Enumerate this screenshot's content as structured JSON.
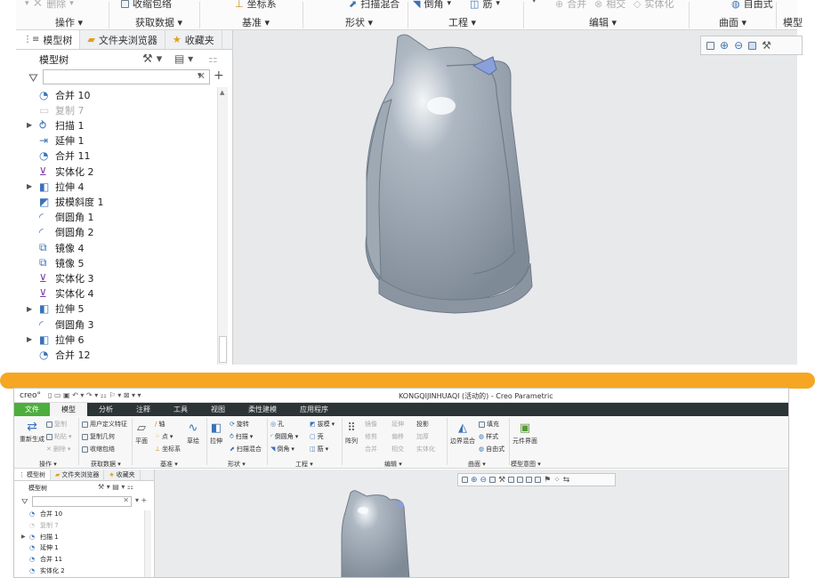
{
  "top": {
    "ribbon_items": [
      {
        "label": "删除",
        "disabled": true
      },
      {
        "label": "收缩包络",
        "disabled": false
      },
      {
        "label": "坐标系",
        "disabled": false
      },
      {
        "label": "扫描混合",
        "disabled": false
      },
      {
        "label": "倒角",
        "disabled": false
      },
      {
        "label": "筋",
        "disabled": false
      },
      {
        "label": "合并",
        "disabled": true
      },
      {
        "label": "相交",
        "disabled": true
      },
      {
        "label": "实体化",
        "disabled": true
      },
      {
        "label": "自由式",
        "disabled": false
      }
    ],
    "group_labels": [
      "操作",
      "获取数据",
      "基准",
      "形状",
      "工程",
      "编辑",
      "曲面",
      "模型"
    ],
    "tabs": [
      "模型树",
      "文件夹浏览器",
      "收藏夹"
    ],
    "model_tree_header": "模型树",
    "filter_value": "",
    "tree_rows": [
      {
        "label": "合并 10",
        "expandable": false,
        "dim": false,
        "icon": "merge-icon"
      },
      {
        "label": "复制 7",
        "expandable": false,
        "dim": true,
        "icon": "copy-icon"
      },
      {
        "label": "扫描 1",
        "expandable": true,
        "dim": false,
        "icon": "sweep-icon"
      },
      {
        "label": "延伸 1",
        "expandable": false,
        "dim": false,
        "icon": "extend-icon"
      },
      {
        "label": "合并 11",
        "expandable": false,
        "dim": false,
        "icon": "merge-icon"
      },
      {
        "label": "实体化 2",
        "expandable": false,
        "dim": false,
        "icon": "solidify-icon"
      },
      {
        "label": "拉伸 4",
        "expandable": true,
        "dim": false,
        "icon": "extrude-icon"
      },
      {
        "label": "拔模斜度 1",
        "expandable": false,
        "dim": false,
        "icon": "draft-icon"
      },
      {
        "label": "倒圆角 1",
        "expandable": false,
        "dim": false,
        "icon": "round-icon"
      },
      {
        "label": "倒圆角 2",
        "expandable": false,
        "dim": false,
        "icon": "round-icon"
      },
      {
        "label": "镜像 4",
        "expandable": false,
        "dim": false,
        "icon": "mirror-icon"
      },
      {
        "label": "镜像 5",
        "expandable": false,
        "dim": false,
        "icon": "mirror-icon"
      },
      {
        "label": "实体化 3",
        "expandable": false,
        "dim": false,
        "icon": "solidify-icon"
      },
      {
        "label": "实体化 4",
        "expandable": false,
        "dim": false,
        "icon": "solidify-icon"
      },
      {
        "label": "拉伸 5",
        "expandable": true,
        "dim": false,
        "icon": "extrude-icon"
      },
      {
        "label": "倒圆角 3",
        "expandable": false,
        "dim": false,
        "icon": "round-icon"
      },
      {
        "label": "拉伸 6",
        "expandable": true,
        "dim": false,
        "icon": "extrude-icon"
      },
      {
        "label": "合并 12",
        "expandable": false,
        "dim": false,
        "icon": "merge-icon"
      }
    ]
  },
  "bottom": {
    "logo": "creo°",
    "window_title": "KONGQIJINHUAQI (活动的) - Creo Parametric",
    "menus": [
      "文件",
      "模型",
      "分析",
      "注释",
      "工具",
      "视图",
      "柔性建模",
      "应用程序"
    ],
    "active_menu": "模型",
    "ribbon": {
      "ops": {
        "regen": "重新生成",
        "copy": "复制",
        "paste": "粘贴",
        "delete": "删除"
      },
      "get_data": {
        "udf": "用户定义特征",
        "copy_geom": "复制几何",
        "shrinkwrap": "收缩包络"
      },
      "datum": {
        "plane": "平面",
        "axis": "轴",
        "point": "点",
        "csys": "坐标系",
        "sketch": "草绘"
      },
      "shape": {
        "extrude": "拉伸",
        "revolve": "旋转",
        "sweep": "扫描",
        "swept_blend": "扫描混合"
      },
      "engineering": {
        "hole": "孔",
        "round": "倒圆角",
        "chamfer": "倒角",
        "draft": "拔模",
        "shell": "壳",
        "rib": "筋"
      },
      "edit": {
        "pattern": "阵列",
        "mirror": "镜像",
        "trim": "修剪",
        "merge": "合并",
        "extend": "延伸",
        "offset": "偏移",
        "intersect": "相交",
        "project": "投影",
        "thicken": "加厚",
        "solidify": "实体化"
      },
      "surfaces": {
        "boundary_blend": "边界混合",
        "fill": "填充",
        "style": "样式",
        "freestyle": "自由式"
      },
      "model_intent": {
        "component_interface": "元件界面"
      }
    },
    "group_labels": [
      "操作",
      "获取数据",
      "基准",
      "形状",
      "工程",
      "编辑",
      "曲面",
      "模型意图"
    ],
    "tabs": [
      "模型树",
      "文件夹浏览器",
      "收藏夹"
    ],
    "model_tree_header": "模型树",
    "tree_rows": [
      {
        "label": "合并 10",
        "expandable": false,
        "dim": false
      },
      {
        "label": "复制 7",
        "expandable": false,
        "dim": true
      },
      {
        "label": "扫描 1",
        "expandable": true,
        "dim": false
      },
      {
        "label": "延伸 1",
        "expandable": false,
        "dim": false
      },
      {
        "label": "合并 11",
        "expandable": false,
        "dim": false
      },
      {
        "label": "实体化 2",
        "expandable": false,
        "dim": false
      }
    ]
  },
  "colors": {
    "accent_orange": "#f5a623",
    "file_menu_green": "#4cae3c",
    "menubar_dark": "#2d3436",
    "model_gray": "#9aa5b1",
    "viewport_bg": "#e8e9eb"
  }
}
